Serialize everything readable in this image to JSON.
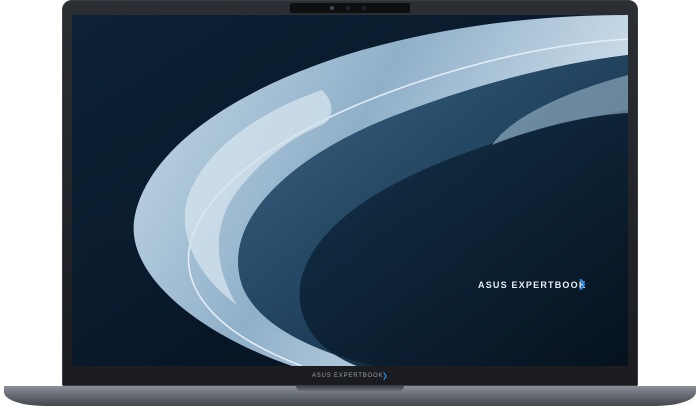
{
  "product": {
    "screen_brand": "ASUS EXPERTBOOK",
    "bezel_brand": "ASUS EXPERTBOOK",
    "chevron": "❯"
  },
  "colors": {
    "chassis": "#5d6168",
    "bezel": "#1f2125",
    "wallpaper_dark": "#061320",
    "wallpaper_wave": "#9cbad3",
    "accent": "#2b8ee8"
  },
  "icons": {
    "webcam": "webcam-icon",
    "chevron": "chevron-right-icon"
  }
}
